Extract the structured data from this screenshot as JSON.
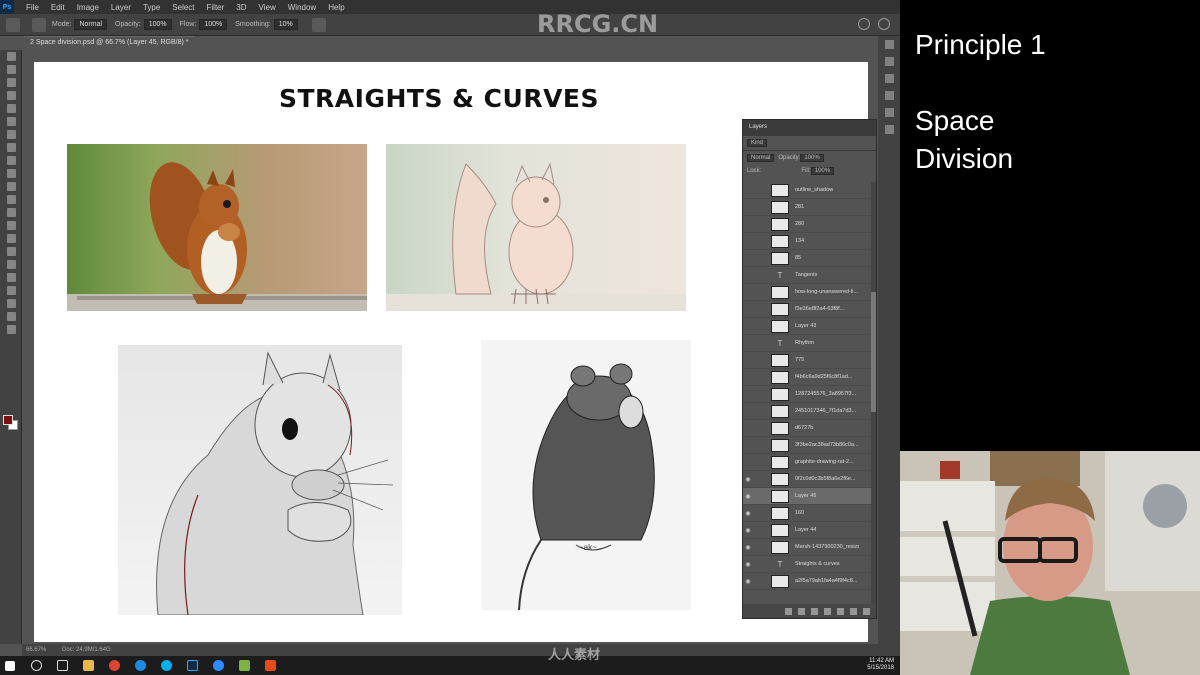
{
  "menubar": {
    "logo": "Ps",
    "items": [
      "File",
      "Edit",
      "Image",
      "Layer",
      "Type",
      "Select",
      "Filter",
      "3D",
      "View",
      "Window",
      "Help"
    ]
  },
  "options": {
    "mode_label": "Mode:",
    "mode_value": "Normal",
    "opacity_label": "Opacity:",
    "opacity_value": "100%",
    "flow_label": "Flow:",
    "flow_value": "100%",
    "smoothing_label": "Smoothing:",
    "smoothing_value": "10%"
  },
  "document": {
    "tab": "2 Space division.psd @ 66.7% (Layer 45, RGB/8) *",
    "zoom": "66.67%",
    "doc_size": "Doc: 24.9M/1.64G"
  },
  "slide": {
    "title": "STRAIGHTS & CURVES"
  },
  "layers_panel": {
    "tab": "Layers",
    "kind_label": "Kind",
    "blend_mode": "Normal",
    "opacity_label": "Opacity:",
    "opacity_value": "100%",
    "lock_label": "Lock:",
    "fill_label": "Fill:",
    "fill_value": "100%",
    "layers": [
      {
        "name": "outline_shadow",
        "type": "image",
        "visible": false,
        "active": false
      },
      {
        "name": "281",
        "type": "image",
        "visible": false,
        "active": false
      },
      {
        "name": "280",
        "type": "image",
        "visible": false,
        "active": false
      },
      {
        "name": "134",
        "type": "image",
        "visible": false,
        "active": false
      },
      {
        "name": "85",
        "type": "image",
        "visible": false,
        "active": false
      },
      {
        "name": "Tangents",
        "type": "text",
        "visible": false,
        "active": false
      },
      {
        "name": "how-long-unanswered-li...",
        "type": "image",
        "visible": false,
        "active": false
      },
      {
        "name": "f3e36e8f2a4-63f8f...",
        "type": "image",
        "visible": false,
        "active": false
      },
      {
        "name": "Layer 43",
        "type": "image",
        "visible": false,
        "active": false
      },
      {
        "name": "Rhythm",
        "type": "text",
        "visible": false,
        "active": false
      },
      {
        "name": "775",
        "type": "image",
        "visible": false,
        "active": false
      },
      {
        "name": "f4b6c6a9d25f6c8f1ad...",
        "type": "image",
        "visible": false,
        "active": false
      },
      {
        "name": "1287245576_3a8957f3...",
        "type": "image",
        "visible": false,
        "active": false
      },
      {
        "name": "2451017346_7f1da7d3...",
        "type": "image",
        "visible": false,
        "active": false
      },
      {
        "name": "d6727b",
        "type": "image",
        "visible": false,
        "active": false
      },
      {
        "name": "3f3be2ac38ad73b86c0a...",
        "type": "image",
        "visible": false,
        "active": false
      },
      {
        "name": "graphite-drawing-rat-2...",
        "type": "image",
        "visible": false,
        "active": false
      },
      {
        "name": "0f2c0d0c3b5f8a6e2f6e...",
        "type": "image",
        "visible": true,
        "active": false
      },
      {
        "name": "Layer 45",
        "type": "image",
        "visible": true,
        "active": true
      },
      {
        "name": "160",
        "type": "image",
        "visible": true,
        "active": false
      },
      {
        "name": "Layer 44",
        "type": "image",
        "visible": true,
        "active": false
      },
      {
        "name": "Marsh-1437900230_resize...",
        "type": "image",
        "visible": true,
        "active": false
      },
      {
        "name": "Straights & curves",
        "type": "text",
        "visible": true,
        "active": false
      },
      {
        "name": "a2f5a79ab1fa4a4f9f4c8...",
        "type": "image",
        "visible": true,
        "active": false
      }
    ]
  },
  "overlay": {
    "line1": "Principle 1",
    "line2": "Space",
    "line3": "Division"
  },
  "watermarks": {
    "top": "RRCG.CN",
    "bottom": "人人素材"
  },
  "taskbar": {
    "time": "11:42 AM",
    "date": "5/15/2018"
  },
  "colors": {
    "ps_bg": "#535353",
    "panel_bg": "#424242",
    "foreground_swatch": "#7a1010",
    "overlay_bg": "#000000"
  }
}
